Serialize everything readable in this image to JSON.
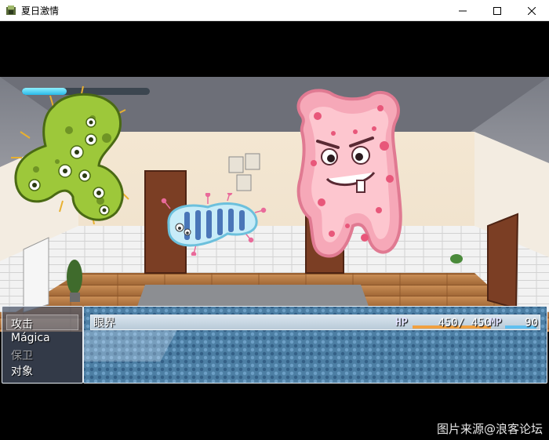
{
  "window": {
    "title": "夏日激情",
    "controls": [
      "minimize",
      "maximize",
      "close"
    ]
  },
  "battle": {
    "top_gauge": {
      "fill_fraction": 0.35,
      "color": "#28b8e8"
    },
    "enemies": [
      {
        "icon": "green-germ-enemy"
      },
      {
        "icon": "blue-striped-bacteria-enemy"
      },
      {
        "icon": "pink-blob-monster-enemy"
      }
    ]
  },
  "command_window": {
    "items": [
      {
        "label": "攻击",
        "enabled": true,
        "selected": true
      },
      {
        "label": "Mágica",
        "enabled": true,
        "selected": false
      },
      {
        "label": "保卫",
        "enabled": false,
        "selected": false
      },
      {
        "label": "对象",
        "enabled": true,
        "selected": false
      }
    ]
  },
  "status_window": {
    "actor": {
      "name": "眼界",
      "hp_label": "HP",
      "hp": "450/ 450",
      "hp_fraction": 1.0,
      "mp_label": "MP",
      "mp": "90",
      "mp_fraction": 1.0
    }
  },
  "colors": {
    "hp_gauge": "#f0a040",
    "mp_gauge": "#60c0f0",
    "window_bg": "#4d7fa4"
  },
  "watermark": "图片来源@浪客论坛"
}
